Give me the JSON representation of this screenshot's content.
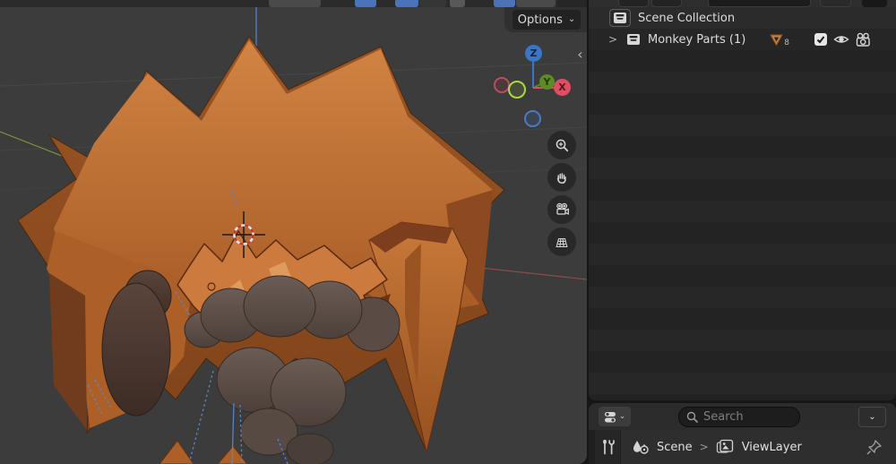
{
  "colors": {
    "viewport_bg": "#3c3c3c",
    "panel_bg": "#262626",
    "model_orange": "#c9763c",
    "muzzle_gray": "#5c5049",
    "axis_x": "#dd4f63",
    "axis_y": "#5d8b25",
    "axis_z": "#3a76c6",
    "header_button_blue": "#4b74b8",
    "cursor_red": "#c03535"
  },
  "viewport": {
    "options_label": "Options",
    "options_chevron": "⌄",
    "collapse_glyph": "‹",
    "gizmo": {
      "x_label": "X",
      "y_label": "Y",
      "z_label": "Z"
    },
    "nav_tools": [
      "zoom",
      "pan",
      "camera-view",
      "toggle-orthographic"
    ]
  },
  "outliner": {
    "expand_glyph": ">",
    "rows": [
      {
        "label": "Scene Collection"
      },
      {
        "label": "Monkey Parts (1)",
        "mesh_count": "8"
      }
    ]
  },
  "properties": {
    "editor_chevron": "⌄",
    "search_placeholder": "Search",
    "dropdown_chevron": "⌄",
    "breadcrumb": {
      "scene": "Scene",
      "separator": ">",
      "viewlayer": "ViewLayer"
    }
  }
}
